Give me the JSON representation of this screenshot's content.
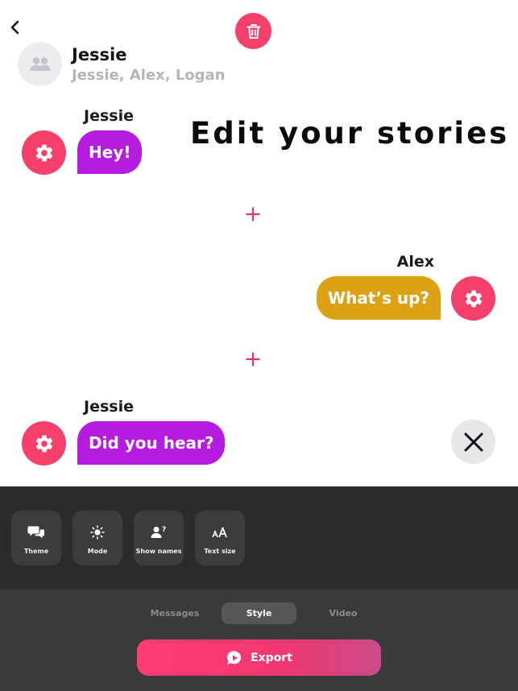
{
  "header": {
    "conversation_name": "Jessie",
    "members": "Jessie, Alex, Logan"
  },
  "headline": "Edit your stories",
  "messages": [
    {
      "sender": "Jessie",
      "text": "Hey!",
      "side": "left",
      "color": "#b61be0"
    },
    {
      "sender": "Alex",
      "text": "What’s up?",
      "side": "right",
      "color": "#dda114"
    },
    {
      "sender": "Jessie",
      "text": "Did you hear?",
      "side": "left",
      "color": "#b61be0"
    }
  ],
  "style_options": [
    {
      "label": "Theme",
      "icon": "chat-bubbles-icon"
    },
    {
      "label": "Mode",
      "icon": "sun-icon"
    },
    {
      "label": "Show names",
      "icon": "person-question-icon"
    },
    {
      "label": "Text size",
      "icon": "text-size-icon"
    }
  ],
  "tabs": [
    {
      "label": "Messages",
      "active": false
    },
    {
      "label": "Style",
      "active": true
    },
    {
      "label": "Video",
      "active": false
    }
  ],
  "export_label": "Export",
  "colors": {
    "accent": "#f5406b",
    "panel_dark": "#2b2b2b",
    "panel_darker": "#3a3a3a"
  }
}
